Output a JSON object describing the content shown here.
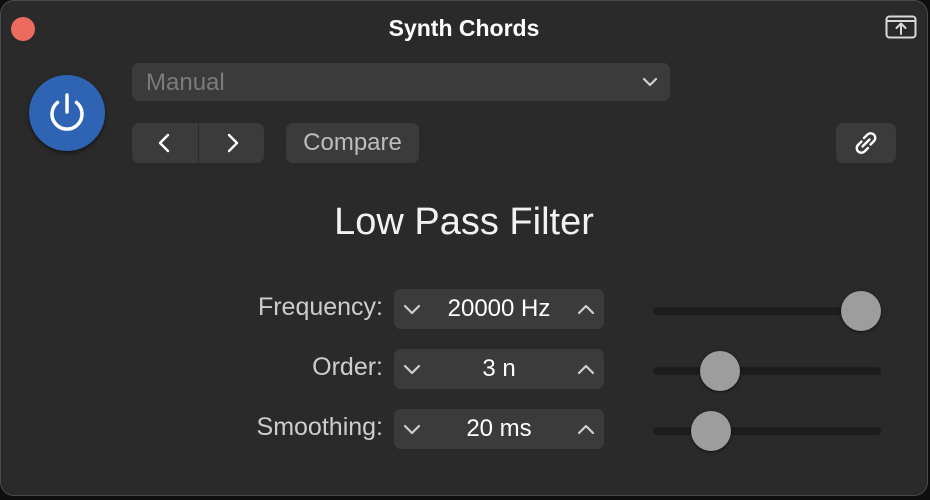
{
  "window": {
    "title": "Synth Chords"
  },
  "toolbar": {
    "preset_value": "Manual",
    "compare_label": "Compare"
  },
  "section": {
    "title": "Low Pass Filter"
  },
  "params": [
    {
      "id": "frequency",
      "label": "Frequency:",
      "value": "20000 Hz",
      "level": 1.0
    },
    {
      "id": "order",
      "label": "Order:",
      "value": "3 n",
      "level": 0.25
    },
    {
      "id": "smoothing",
      "label": "Smoothing:",
      "value": "20 ms",
      "level": 0.2
    }
  ],
  "colors": {
    "power_accent": "#2f64b4",
    "close_button": "#ec6a5e",
    "background": "#2a2a2b"
  },
  "icons": {
    "close": "close-icon",
    "share": "share-icon",
    "power": "power-icon",
    "chevron": "chevron-down-icon",
    "prev": "chevron-left-icon",
    "next": "chevron-right-icon",
    "link": "link-icon",
    "decrement": "chevron-down-icon",
    "increment": "chevron-up-icon"
  }
}
